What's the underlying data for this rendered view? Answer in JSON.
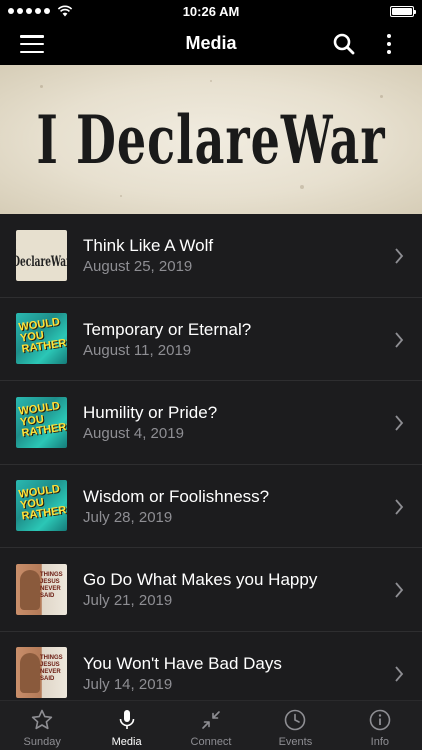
{
  "status_bar": {
    "time": "10:26 AM"
  },
  "nav": {
    "title": "Media"
  },
  "banner": {
    "title": "I DeclareWar"
  },
  "items": [
    {
      "title": "Think Like A Wolf",
      "date": "August 25, 2019",
      "thumb": "i-declare-war"
    },
    {
      "title": "Temporary or Eternal?",
      "date": "August 11, 2019",
      "thumb": "would-you-rather"
    },
    {
      "title": "Humility or Pride?",
      "date": "August 4, 2019",
      "thumb": "would-you-rather"
    },
    {
      "title": "Wisdom or Foolishness?",
      "date": "July 28, 2019",
      "thumb": "would-you-rather"
    },
    {
      "title": "Go Do What Makes you Happy",
      "date": "July 21, 2019",
      "thumb": "things-jesus-never-said"
    },
    {
      "title": "You Won't Have Bad Days",
      "date": "July 14, 2019",
      "thumb": "things-jesus-never-said"
    }
  ],
  "thumb_text": {
    "war": "I DeclareWar",
    "rather_1": "WOULD",
    "rather_2": "YOU",
    "rather_3": "RATHER?",
    "jesus_1": "THINGS",
    "jesus_2": "JESUS",
    "jesus_3": "NEVER",
    "jesus_4": "SAID"
  },
  "tabs": [
    {
      "label": "Sunday",
      "icon": "star-icon",
      "active": false
    },
    {
      "label": "Media",
      "icon": "microphone-icon",
      "active": true
    },
    {
      "label": "Connect",
      "icon": "connect-arrows-icon",
      "active": false
    },
    {
      "label": "Events",
      "icon": "clock-icon",
      "active": false
    },
    {
      "label": "Info",
      "icon": "info-icon",
      "active": false
    }
  ],
  "colors": {
    "background": "#1c1c1e",
    "bar": "#000000",
    "secondary_text": "#8e8e93",
    "active_tab": "#ffffff"
  }
}
